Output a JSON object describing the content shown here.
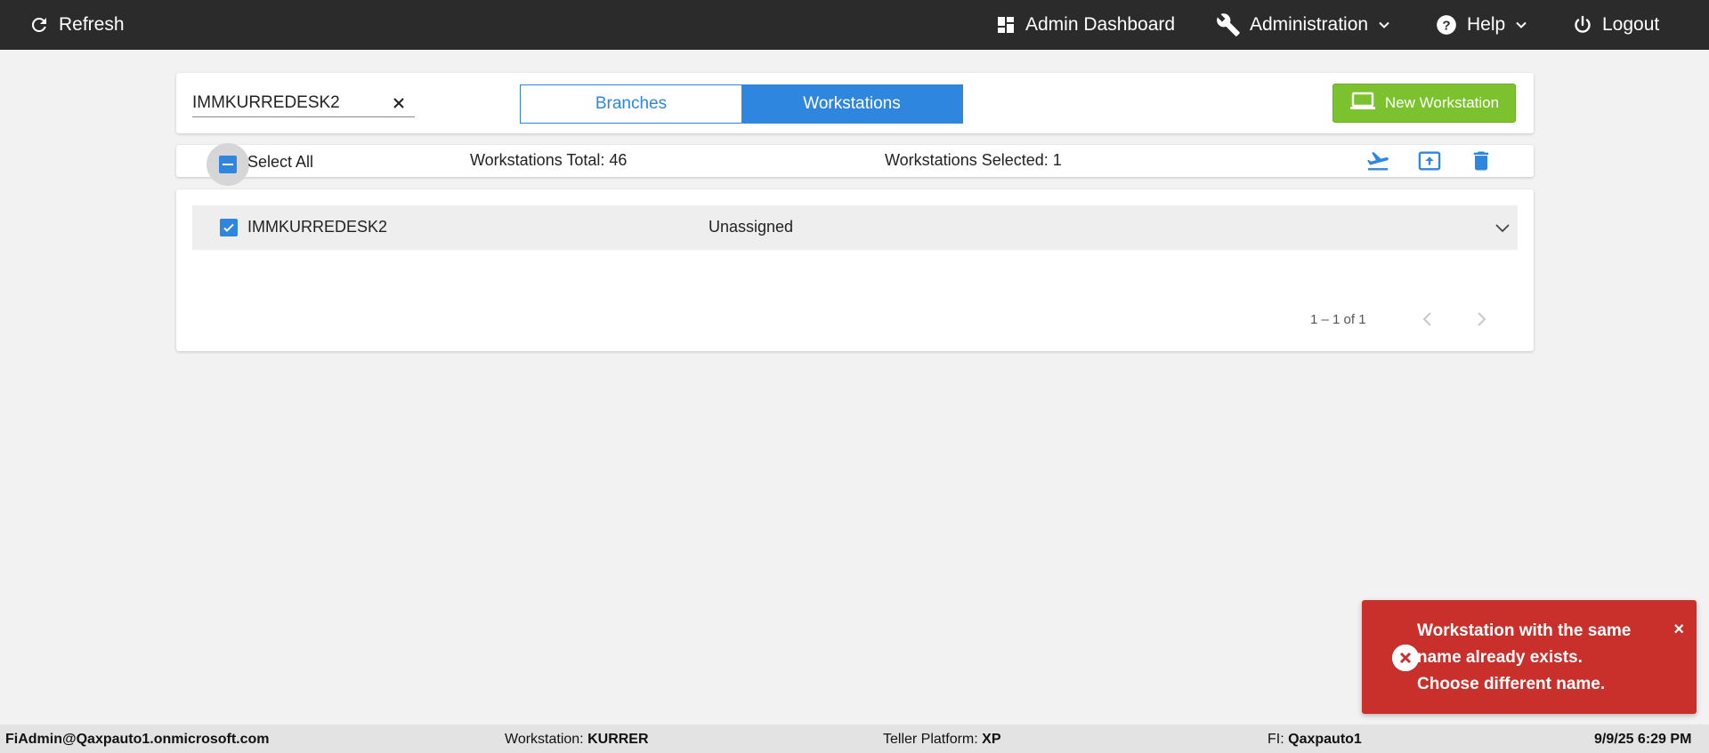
{
  "topbar": {
    "refresh_label": "Refresh",
    "admin_dashboard_label": "Admin Dashboard",
    "administration_label": "Administration",
    "help_label": "Help",
    "logout_label": "Logout"
  },
  "search": {
    "value": "IMMKURREDESK2"
  },
  "view_toggle": {
    "branches_label": "Branches",
    "workstations_label": "Workstations",
    "active": "Workstations"
  },
  "new_workstation_label": "New Workstation",
  "selection_bar": {
    "select_all_label": "Select All",
    "total_text": "Workstations Total: 46",
    "selected_text": "Workstations Selected: 1"
  },
  "rows": [
    {
      "name": "IMMKURREDESK2",
      "branch": "Unassigned",
      "checked": true
    }
  ],
  "pagination": {
    "range_text": "1 – 1 of 1"
  },
  "toast": {
    "message": "Workstation with the same name already exists. Choose different name.",
    "close_label": "×"
  },
  "statusbar": {
    "user": "FiAdmin@Qaxpauto1.onmicrosoft.com",
    "workstation_label": "Workstation:",
    "workstation_value": "KURRER",
    "platform_label": "Teller Platform:",
    "platform_value": "XP",
    "fi_label": "FI:",
    "fi_value": "Qaxpauto1",
    "datetime": "9/9/25 6:29 PM"
  },
  "colors": {
    "topbar_bg": "#2b2b2b",
    "accent_blue": "#2e86de",
    "new_button_green": "#7cc22e",
    "toast_red": "#c9302c"
  }
}
